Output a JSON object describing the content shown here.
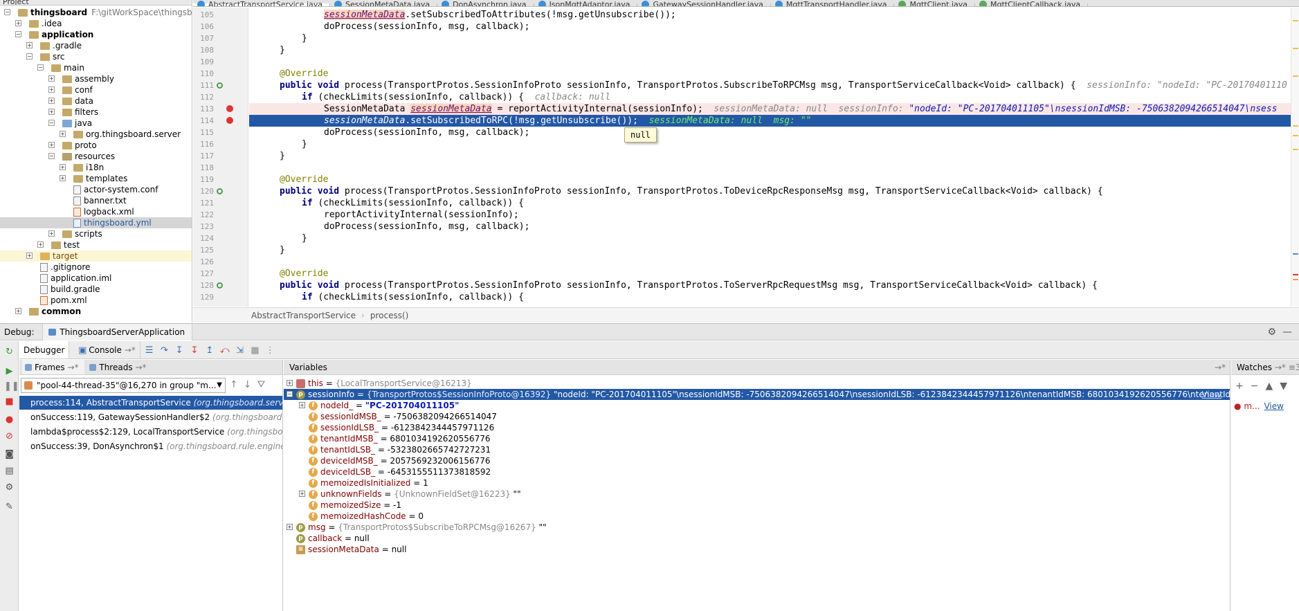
{
  "project": {
    "header": "Project",
    "tree": [
      {
        "name": "thingsboard",
        "extra": "F:\\gitWorkSpace\\thingsboa",
        "indent": 0,
        "type": "folder",
        "expanded": true,
        "bold": true
      },
      {
        "name": ".idea",
        "indent": 1,
        "type": "folder",
        "expanded": false
      },
      {
        "name": "application",
        "indent": 1,
        "type": "folder",
        "expanded": true,
        "bold": true
      },
      {
        "name": ".gradle",
        "indent": 2,
        "type": "folder",
        "expanded": false
      },
      {
        "name": "src",
        "indent": 2,
        "type": "folder",
        "expanded": true
      },
      {
        "name": "main",
        "indent": 3,
        "type": "folder",
        "expanded": true
      },
      {
        "name": "assembly",
        "indent": 4,
        "type": "folder",
        "expanded": false
      },
      {
        "name": "conf",
        "indent": 4,
        "type": "folder",
        "expanded": false
      },
      {
        "name": "data",
        "indent": 4,
        "type": "folder",
        "expanded": false
      },
      {
        "name": "filters",
        "indent": 4,
        "type": "folder",
        "expanded": false
      },
      {
        "name": "java",
        "indent": 4,
        "type": "src",
        "expanded": true
      },
      {
        "name": "org.thingsboard.server",
        "indent": 5,
        "type": "folder",
        "expanded": false
      },
      {
        "name": "proto",
        "indent": 4,
        "type": "folder",
        "expanded": false
      },
      {
        "name": "resources",
        "indent": 4,
        "type": "res",
        "expanded": true
      },
      {
        "name": "i18n",
        "indent": 5,
        "type": "folder",
        "expanded": false
      },
      {
        "name": "templates",
        "indent": 5,
        "type": "folder",
        "expanded": false
      },
      {
        "name": "actor-system.conf",
        "indent": 5,
        "type": "file"
      },
      {
        "name": "banner.txt",
        "indent": 5,
        "type": "file"
      },
      {
        "name": "logback.xml",
        "indent": 5,
        "type": "xml"
      },
      {
        "name": "thingsboard.yml",
        "indent": 5,
        "type": "yml",
        "selected": true
      },
      {
        "name": "scripts",
        "indent": 4,
        "type": "folder",
        "expanded": false
      },
      {
        "name": "test",
        "indent": 3,
        "type": "folder",
        "expanded": false
      },
      {
        "name": "target",
        "indent": 2,
        "type": "target",
        "expanded": false,
        "excluded": true
      },
      {
        "name": ".gitignore",
        "indent": 2,
        "type": "file"
      },
      {
        "name": "application.iml",
        "indent": 2,
        "type": "file"
      },
      {
        "name": "build.gradle",
        "indent": 2,
        "type": "file"
      },
      {
        "name": "pom.xml",
        "indent": 2,
        "type": "xml"
      },
      {
        "name": "common",
        "indent": 1,
        "type": "folder",
        "expanded": false,
        "bold": true
      }
    ]
  },
  "tabs": [
    {
      "label": "AbstractTransportService.java",
      "active": true
    },
    {
      "label": "SessionMetaData.java"
    },
    {
      "label": "DonAsynchron.java"
    },
    {
      "label": "JsonMqttAdaptor.java"
    },
    {
      "label": "GatewaySessionHandler.java"
    },
    {
      "label": "MqttTransportHandler.java"
    },
    {
      "label": "MqttClient.java"
    },
    {
      "label": "MqttClientCallback.java"
    }
  ],
  "editor": {
    "lines": [
      {
        "n": "105",
        "indent": 3,
        "parts": [
          [
            "fld-hl",
            "sessionMetaData"
          ],
          [
            "",
            "."
          ],
          [
            "",
            "setSubscribedToAttributes(!msg.getUnsubscribe());"
          ]
        ]
      },
      {
        "n": "106",
        "indent": 3,
        "parts": [
          [
            "",
            "doProcess(sessionInfo, msg, callback);"
          ]
        ]
      },
      {
        "n": "107",
        "indent": 2,
        "parts": [
          [
            "",
            "}"
          ]
        ]
      },
      {
        "n": "108",
        "indent": 1,
        "parts": [
          [
            "",
            "}"
          ]
        ]
      },
      {
        "n": "109",
        "indent": 0,
        "parts": []
      },
      {
        "n": "110",
        "indent": 1,
        "parts": [
          [
            "ann",
            "@Override"
          ]
        ]
      },
      {
        "n": "111",
        "indent": 1,
        "mark": "override",
        "parts": [
          [
            "kw",
            "public void "
          ],
          [
            "",
            "process(TransportProtos.SessionInfoProto sessionInfo, TransportProtos.SubscribeToRPCMsg msg, TransportServiceCallback<Void> callback) {  "
          ],
          [
            "inl",
            "sessionInfo: \"nodeId: \"PC-20170401110"
          ]
        ]
      },
      {
        "n": "112",
        "indent": 2,
        "parts": [
          [
            "kw",
            "if "
          ],
          [
            "",
            "(checkLimits(sessionInfo, callback)) {  "
          ],
          [
            "inl",
            "callback: null"
          ]
        ]
      },
      {
        "n": "113",
        "indent": 3,
        "mark": "bp",
        "bg": "bp",
        "parts": [
          [
            "",
            "SessionMetaData "
          ],
          [
            "hlv",
            "sessionMetaData"
          ],
          [
            "",
            " = reportActivityInternal(sessionInfo);  "
          ],
          [
            "inl",
            "sessionMetaData: null  sessionInfo: "
          ],
          [
            "str",
            "\"nodeId: \"PC-201704011105\"\\nsessionIdMSB: -7506382094266514047\\nsess"
          ]
        ]
      },
      {
        "n": "114",
        "indent": 3,
        "mark": "bp",
        "bg": "exec",
        "parts": [
          [
            "fld",
            "sessionMetaData"
          ],
          [
            "",
            ".setSubscribedToRPC(!msg.getUnsubscribe());  "
          ],
          [
            "inl",
            "sessionMetaData: null  msg: \"\""
          ]
        ]
      },
      {
        "n": "115",
        "indent": 3,
        "parts": [
          [
            "",
            "doProcess(sessionInfo, msg, callback);"
          ]
        ]
      },
      {
        "n": "116",
        "indent": 2,
        "parts": [
          [
            "",
            "}"
          ]
        ]
      },
      {
        "n": "117",
        "indent": 1,
        "parts": [
          [
            "",
            "}"
          ]
        ]
      },
      {
        "n": "118",
        "indent": 0,
        "parts": []
      },
      {
        "n": "119",
        "indent": 1,
        "parts": [
          [
            "ann",
            "@Override"
          ]
        ]
      },
      {
        "n": "120",
        "indent": 1,
        "mark": "override",
        "parts": [
          [
            "kw",
            "public void "
          ],
          [
            "",
            "process(TransportProtos.SessionInfoProto sessionInfo, TransportProtos.ToDeviceRpcResponseMsg msg, TransportServiceCallback<Void> callback) {"
          ]
        ]
      },
      {
        "n": "121",
        "indent": 2,
        "parts": [
          [
            "kw",
            "if "
          ],
          [
            "",
            "(checkLimits(sessionInfo, callback)) {"
          ]
        ]
      },
      {
        "n": "122",
        "indent": 3,
        "parts": [
          [
            "",
            "reportActivityInternal(sessionInfo);"
          ]
        ]
      },
      {
        "n": "123",
        "indent": 3,
        "parts": [
          [
            "",
            "doProcess(sessionInfo, msg, callback);"
          ]
        ]
      },
      {
        "n": "124",
        "indent": 2,
        "parts": [
          [
            "",
            "}"
          ]
        ]
      },
      {
        "n": "125",
        "indent": 1,
        "parts": [
          [
            "",
            "}"
          ]
        ]
      },
      {
        "n": "126",
        "indent": 0,
        "parts": []
      },
      {
        "n": "127",
        "indent": 1,
        "parts": [
          [
            "ann",
            "@Override"
          ]
        ]
      },
      {
        "n": "128",
        "indent": 1,
        "mark": "override",
        "parts": [
          [
            "kw",
            "public void "
          ],
          [
            "",
            "process(TransportProtos.SessionInfoProto sessionInfo, TransportProtos.ToServerRpcRequestMsg msg, TransportServiceCallback<Void> callback) {"
          ]
        ]
      },
      {
        "n": "129",
        "indent": 2,
        "parts": [
          [
            "kw",
            "if "
          ],
          [
            "",
            "(checkLimits(sessionInfo, callback)) {"
          ]
        ]
      }
    ],
    "tooltip": "null"
  },
  "breadcrumb": [
    "AbstractTransportService",
    "process()"
  ],
  "debug": {
    "label": "Debug:",
    "run_config": "ThingsboardServerApplication",
    "tab_debugger": "Debugger",
    "tab_console": "Console",
    "frames_tab": "Frames",
    "threads_tab": "Threads",
    "thread_selector": "\"pool-44-thread-35\"@16,270 in group \"m...",
    "frames": [
      {
        "method": "process:114, AbstractTransportService",
        "pkg": "(org.thingsboard.server",
        "selected": true
      },
      {
        "method": "onSuccess:119, GatewaySessionHandler$2",
        "pkg": "(org.thingsboard.se"
      },
      {
        "method": "lambda$process$2:129, LocalTransportService",
        "pkg": "(org.thingsboa"
      },
      {
        "method": "onSuccess:39, DonAsynchron$1",
        "pkg": "(org.thingsboard.rule.engine.a"
      }
    ],
    "variables_title": "Variables",
    "variables": [
      {
        "indent": 0,
        "toggle": "+",
        "icon": "t",
        "name": "this",
        "eq": " = ",
        "type": "{LocalTransportService@16213}",
        "value": ""
      },
      {
        "indent": 0,
        "toggle": "-",
        "icon": "p",
        "name": "sessionInfo",
        "eq": " = ",
        "type": "{TransportProtos$SessionInfoProto@16392}",
        "value": " \"nodeId: \"PC-201704011105\"\\nsessionIdMSB: -7506382094266514047\\nsessionIdLSB: -6123842344457971126\\ntenantIdMSB: 6801034192620556776\\ntenantIdL...",
        "selected": true,
        "view": "View"
      },
      {
        "indent": 1,
        "toggle": "+",
        "icon": "f",
        "name": "nodeId_",
        "eq": " = ",
        "type": "",
        "value": "\"PC-201704011105\"",
        "str": true
      },
      {
        "indent": 1,
        "icon": "f",
        "name": "sessionIdMSB_",
        "eq": " = ",
        "type": "",
        "value": "-7506382094266514047"
      },
      {
        "indent": 1,
        "icon": "f",
        "name": "sessionIdLSB_",
        "eq": " = ",
        "type": "",
        "value": "-6123842344457971126"
      },
      {
        "indent": 1,
        "icon": "f",
        "name": "tenantIdMSB_",
        "eq": " = ",
        "type": "",
        "value": "6801034192620556776"
      },
      {
        "indent": 1,
        "icon": "f",
        "name": "tenantIdLSB_",
        "eq": " = ",
        "type": "",
        "value": "-5323802665742727231"
      },
      {
        "indent": 1,
        "icon": "f",
        "name": "deviceIdMSB_",
        "eq": " = ",
        "type": "",
        "value": "2057569232006156776"
      },
      {
        "indent": 1,
        "icon": "f",
        "name": "deviceIdLSB_",
        "eq": " = ",
        "type": "",
        "value": "-6453155511373818592"
      },
      {
        "indent": 1,
        "icon": "f",
        "name": "memoizedIsInitialized",
        "eq": " = ",
        "type": "",
        "value": "1"
      },
      {
        "indent": 1,
        "toggle": "+",
        "icon": "f",
        "name": "unknownFields",
        "eq": " = ",
        "type": "{UnknownFieldSet@16223}",
        "value": " \"\""
      },
      {
        "indent": 1,
        "icon": "f",
        "name": "memoizedSize",
        "eq": " = ",
        "type": "",
        "value": "-1"
      },
      {
        "indent": 1,
        "icon": "f",
        "name": "memoizedHashCode",
        "eq": " = ",
        "type": "",
        "value": "0"
      },
      {
        "indent": 0,
        "toggle": "+",
        "icon": "p",
        "name": "msg",
        "eq": " = ",
        "type": "{TransportProtos$SubscribeToRPCMsg@16267}",
        "value": " \"\""
      },
      {
        "indent": 0,
        "icon": "p",
        "name": "callback",
        "eq": " = ",
        "type": "",
        "value": "null"
      },
      {
        "indent": 0,
        "icon": "lines",
        "name": "sessionMetaData",
        "eq": " = ",
        "type": "",
        "value": "null"
      }
    ],
    "watches_title": "Watches",
    "watch_item": "m...",
    "watch_view": "View"
  },
  "colors": {
    "selection": "#2358a5",
    "breakpoint": "#dd3333",
    "bp_line_bg": "#fbe6e6"
  }
}
